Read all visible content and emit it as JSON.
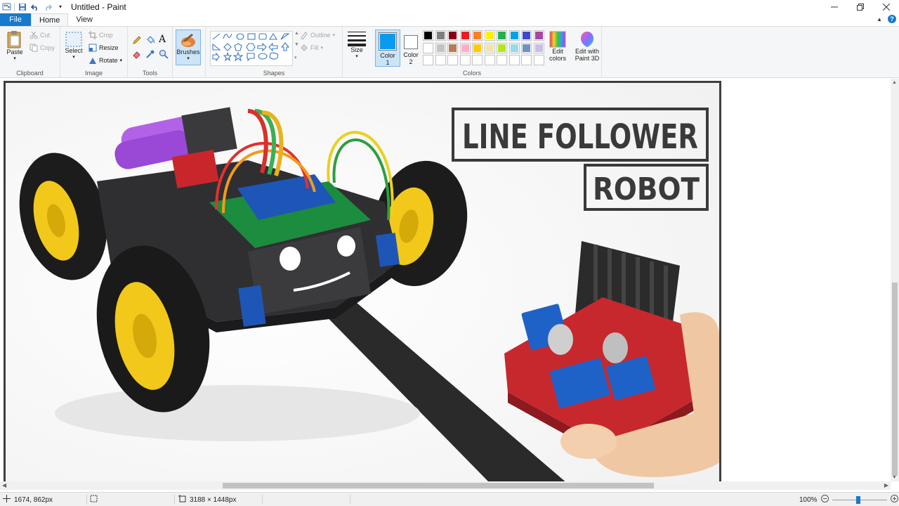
{
  "window": {
    "title": "Untitled - Paint"
  },
  "tabs": {
    "file": "File",
    "home": "Home",
    "view": "View"
  },
  "ribbon": {
    "clipboard": {
      "label": "Clipboard",
      "paste": "Paste",
      "cut": "Cut",
      "copy": "Copy"
    },
    "image": {
      "label": "Image",
      "select": "Select",
      "crop": "Crop",
      "resize": "Resize",
      "rotate": "Rotate"
    },
    "tools": {
      "label": "Tools"
    },
    "brushes": {
      "label": "Brushes"
    },
    "shapes": {
      "label": "Shapes",
      "outline": "Outline",
      "fill": "Fill"
    },
    "size": {
      "label": "Size"
    },
    "colors": {
      "label": "Colors",
      "color1": "Color",
      "color1_num": "1",
      "color2": "Color",
      "color2_num": "2",
      "color1_value": "#0a9af0",
      "color2_value": "#ffffff",
      "edit_colors": "Edit colors",
      "edit_paint3d": "Edit with Paint 3D",
      "palette_row1": [
        "#000000",
        "#7f7f7f",
        "#880015",
        "#ed1c24",
        "#ff7f27",
        "#fff200",
        "#22b14c",
        "#00a2e8",
        "#3f48cc",
        "#a349a4"
      ],
      "palette_row2": [
        "#ffffff",
        "#c3c3c3",
        "#b97a57",
        "#ffaec9",
        "#ffc90e",
        "#efe4b0",
        "#b5e61d",
        "#99d9ea",
        "#7092be",
        "#c8bfe7"
      ]
    }
  },
  "image_content": {
    "headline_line1": "LINE FOLLOWER",
    "headline_line2": "ROBOT"
  },
  "status": {
    "cursor": "1674, 862px",
    "dimensions": "3188 × 1448px",
    "zoom": "100%"
  }
}
